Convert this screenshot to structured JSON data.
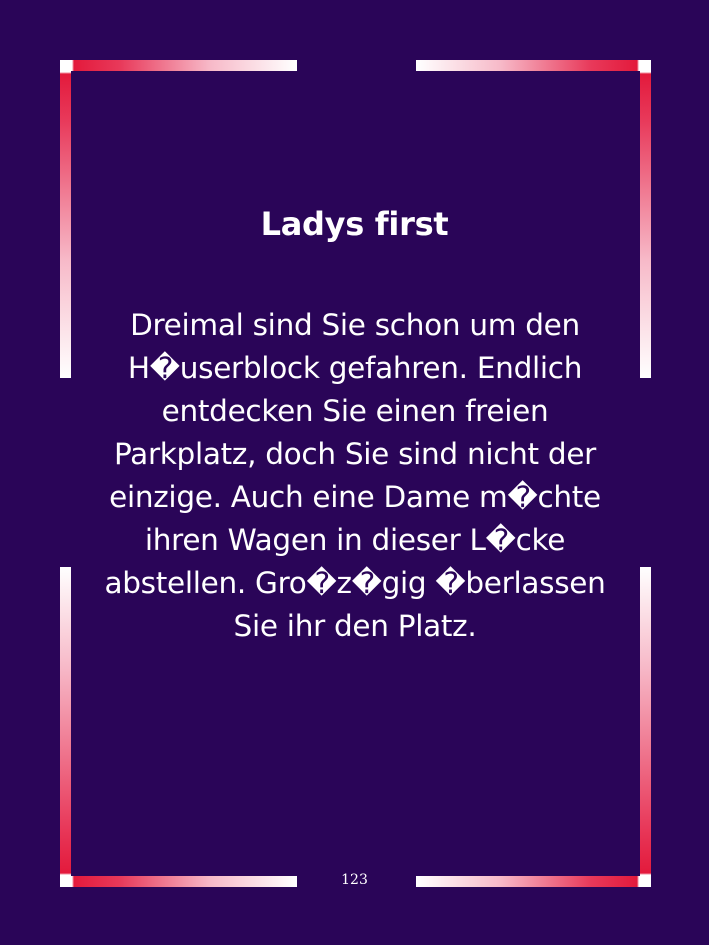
{
  "title": "Ladys first",
  "body": "Dreimal sind Sie schon um den H�userblock gefahren. Endlich entdecken Sie einen freien Parkplatz, doch Sie sind nicht der einzige. Auch eine Dame m�chte ihren Wagen in dieser L�cke abstellen. Gro�z�gig �berlassen Sie ihr den Platz.",
  "page_number": "123",
  "colors": {
    "background": "#2a0558",
    "frame_accent": "#e31a3c",
    "frame_light": "#ffffff",
    "text": "#ffffff"
  }
}
